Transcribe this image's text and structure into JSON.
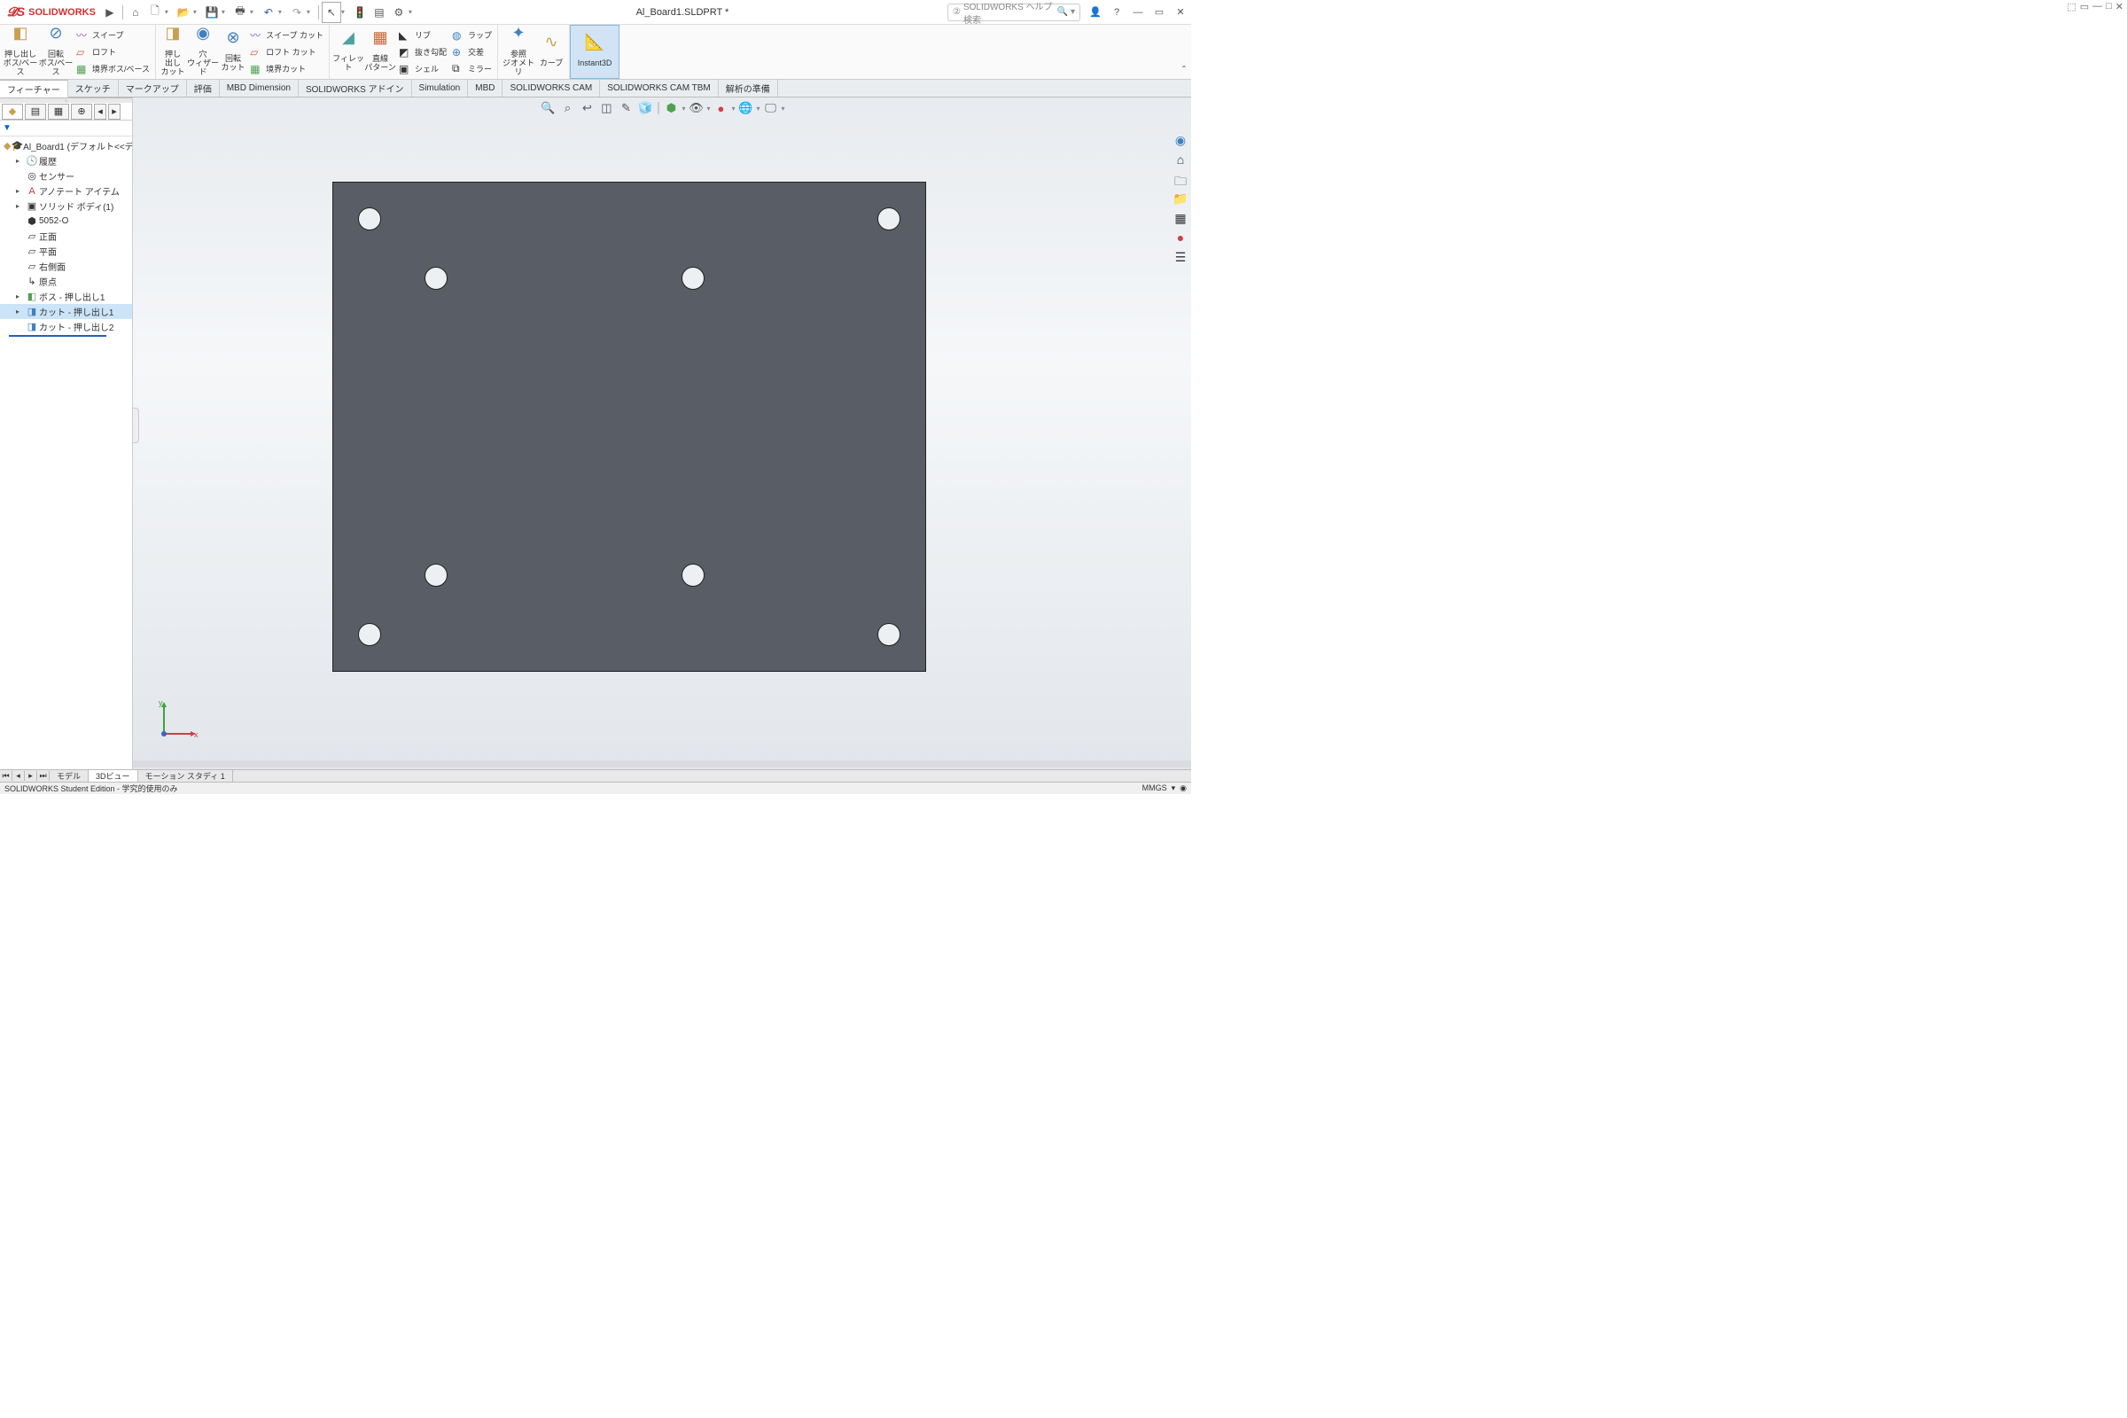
{
  "app": {
    "logo_text": "SOLIDWORKS",
    "title": "Al_Board1.SLDPRT *"
  },
  "search": {
    "placeholder": "SOLIDWORKS ヘルプ検索"
  },
  "ribbon": {
    "extrude_boss": "押し出し\nボス/ベース",
    "revolve_boss": "回転\nボス/ベース",
    "sweep": "スイープ",
    "loft": "ロフト",
    "boundary": "境界ボス/ベース",
    "extrude_cut": "押し\n出し\nカット",
    "hole_wizard": "穴\nウィザード",
    "revolve_cut": "回転\nカット",
    "sweep_cut": "スイープ カット",
    "loft_cut": "ロフト カット",
    "boundary_cut": "境界カット",
    "fillet": "フィレット",
    "linear_pattern": "直線\nパターン",
    "rib": "リブ",
    "draft": "抜き勾配",
    "shell": "シェル",
    "wrap": "ラップ",
    "intersect": "交差",
    "mirror": "ミラー",
    "ref_geom": "参照\nジオメトリ",
    "curves": "カーブ",
    "instant3d": "Instant3D"
  },
  "tabs": [
    "フィーチャー",
    "スケッチ",
    "マークアップ",
    "評価",
    "MBD Dimension",
    "SOLIDWORKS アドイン",
    "Simulation",
    "MBD",
    "SOLIDWORKS CAM",
    "SOLIDWORKS CAM TBM",
    "解析の準備"
  ],
  "tree": {
    "root": "Al_Board1 (デフォルト<<デ",
    "history": "履歴",
    "sensors": "センサー",
    "annotations": "アノテート アイテム",
    "solid_bodies": "ソリッド ボディ(1)",
    "material": "5052-O",
    "front": "正面",
    "top": "平面",
    "right": "右側面",
    "origin": "原点",
    "feat1": "ボス - 押し出し1",
    "feat2": "カット - 押し出し1",
    "feat3": "カット - 押し出し2"
  },
  "sheets": {
    "model": "モデル",
    "view3d": "3Dビュー",
    "motion": "モーション スタディ 1"
  },
  "status": {
    "left": "SOLIDWORKS Student Edition - 学究的使用のみ",
    "units": "MMGS"
  },
  "triad": {
    "x": "x",
    "y": "y"
  }
}
